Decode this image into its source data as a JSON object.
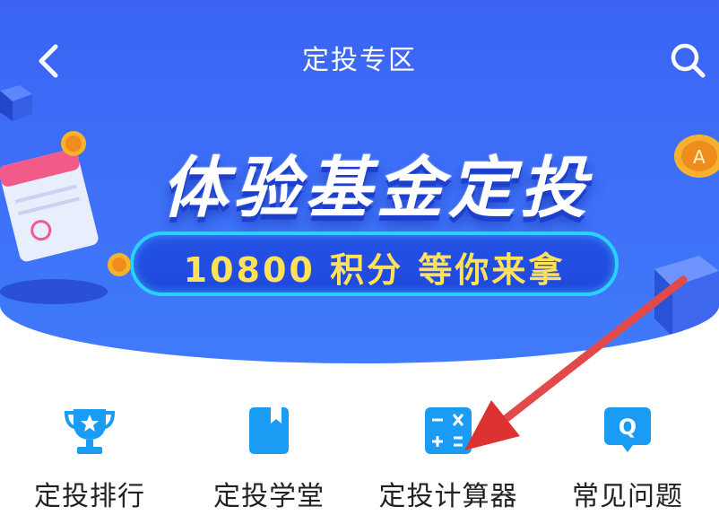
{
  "header": {
    "title": "定投专区",
    "back_icon": "chevron-left-icon",
    "search_icon": "search-icon"
  },
  "banner": {
    "headline": "体验基金定投",
    "subline": "10800 积分  等你来拿"
  },
  "nav": {
    "items": [
      {
        "label": "定投排行",
        "icon": "trophy-icon"
      },
      {
        "label": "定投学堂",
        "icon": "book-icon"
      },
      {
        "label": "定投计算器",
        "icon": "calculator-icon"
      },
      {
        "label": "常见问题",
        "icon": "question-bubble-icon"
      }
    ]
  },
  "colors": {
    "hero_blue": "#3d6cf7",
    "icon_blue": "#1a9cf5",
    "annotation_red": "#e23b3b",
    "sub_yellow": "#ffe25a"
  }
}
